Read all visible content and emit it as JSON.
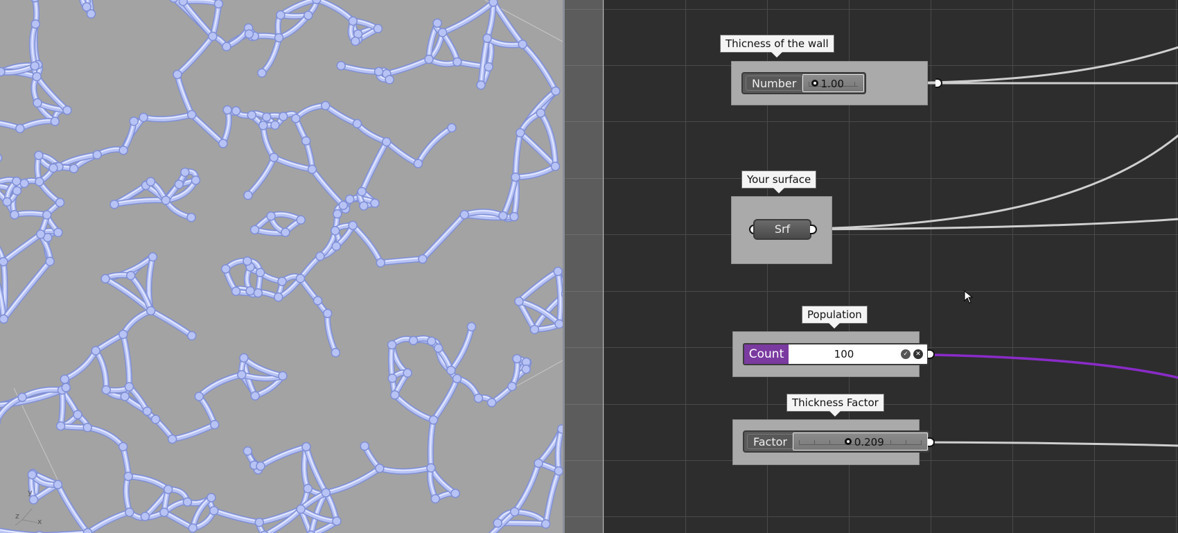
{
  "viewport": {
    "background_color": "#a3a3a3",
    "mesh_color": "#b8c3f5",
    "axes": {
      "y_label": "y",
      "x_label": "x",
      "z_label": "z"
    }
  },
  "canvas": {
    "background_color": "#2d2d2d",
    "wire_color": "#cfcfcf",
    "count_wire_color": "#8a2bc8",
    "nodes": {
      "wall_thickness": {
        "tooltip": "Thicness of the wall",
        "label": "Number",
        "value": "1.00",
        "slider_fraction": 0.12
      },
      "surface": {
        "tooltip": "Your surface",
        "label": "Srf"
      },
      "population": {
        "tooltip": "Population",
        "label": "Count",
        "value": "100",
        "accent": "#7a3aa0"
      },
      "thickness_factor": {
        "tooltip": "Thickness Factor",
        "label": "Factor",
        "value": "0.209",
        "slider_fraction": 0.4
      }
    }
  }
}
